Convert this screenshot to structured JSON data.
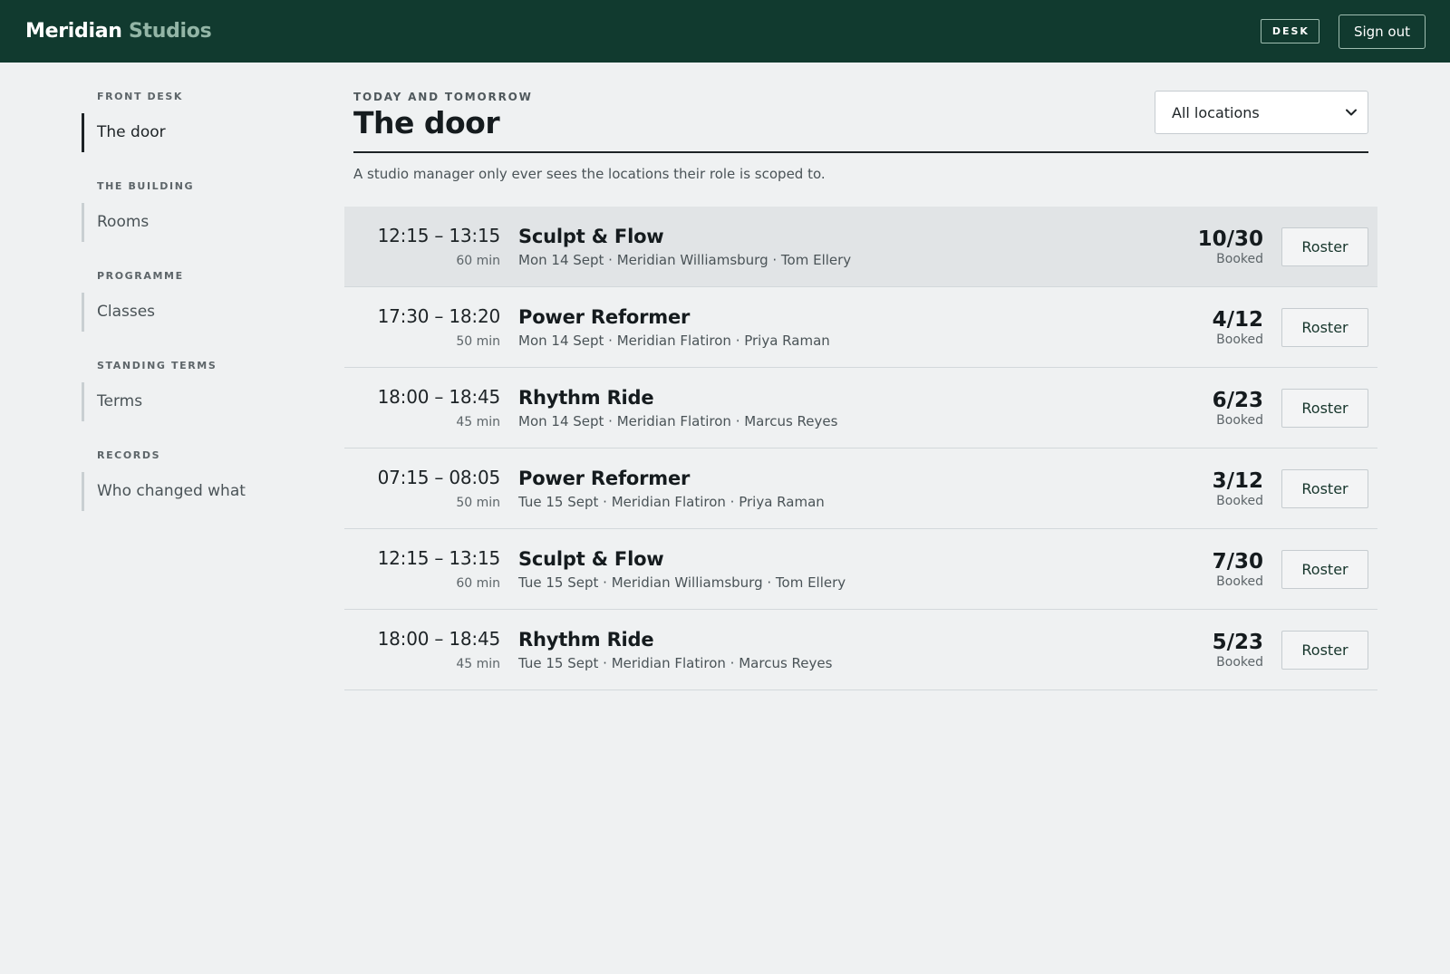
{
  "app": {
    "brand_primary": "Meridian",
    "brand_secondary": "Studios",
    "role_badge": "DESK",
    "signout_label": "Sign out",
    "colors": {
      "topbar": "#113a2f",
      "brand_secondary": "#93b5a6",
      "background": "#eff1f2",
      "row_highlight": "#e1e4e6"
    }
  },
  "sidebar": {
    "groups": [
      {
        "title": "FRONT DESK",
        "items": [
          {
            "label": "The door",
            "active": true
          }
        ]
      },
      {
        "title": "THE BUILDING",
        "items": [
          {
            "label": "Rooms",
            "active": false
          }
        ]
      },
      {
        "title": "PROGRAMME",
        "items": [
          {
            "label": "Classes",
            "active": false
          }
        ]
      },
      {
        "title": "STANDING TERMS",
        "items": [
          {
            "label": "Terms",
            "active": false
          }
        ]
      },
      {
        "title": "RECORDS",
        "items": [
          {
            "label": "Who changed what",
            "active": false
          }
        ]
      }
    ]
  },
  "main": {
    "eyebrow": "TODAY AND TOMORROW",
    "title": "The door",
    "location_filter": {
      "selected": "All locations",
      "icon": "chevron-down-icon"
    },
    "scope_note": "A studio manager only ever sees the locations their role is scoped to.",
    "booked_label": "Booked",
    "roster_label": "Roster",
    "sessions": [
      {
        "time": "12:15 – 13:15",
        "duration": "60 min",
        "name": "Sculpt & Flow",
        "meta": "Mon 14 Sept · Meridian Williamsburg · Tom Ellery",
        "booked": "10/30",
        "highlighted": true
      },
      {
        "time": "17:30 – 18:20",
        "duration": "50 min",
        "name": "Power Reformer",
        "meta": "Mon 14 Sept · Meridian Flatiron · Priya Raman",
        "booked": "4/12",
        "highlighted": false
      },
      {
        "time": "18:00 – 18:45",
        "duration": "45 min",
        "name": "Rhythm Ride",
        "meta": "Mon 14 Sept · Meridian Flatiron · Marcus Reyes",
        "booked": "6/23",
        "highlighted": false
      },
      {
        "time": "07:15 – 08:05",
        "duration": "50 min",
        "name": "Power Reformer",
        "meta": "Tue 15 Sept · Meridian Flatiron · Priya Raman",
        "booked": "3/12",
        "highlighted": false
      },
      {
        "time": "12:15 – 13:15",
        "duration": "60 min",
        "name": "Sculpt & Flow",
        "meta": "Tue 15 Sept · Meridian Williamsburg · Tom Ellery",
        "booked": "7/30",
        "highlighted": false
      },
      {
        "time": "18:00 – 18:45",
        "duration": "45 min",
        "name": "Rhythm Ride",
        "meta": "Tue 15 Sept · Meridian Flatiron · Marcus Reyes",
        "booked": "5/23",
        "highlighted": false
      }
    ]
  }
}
